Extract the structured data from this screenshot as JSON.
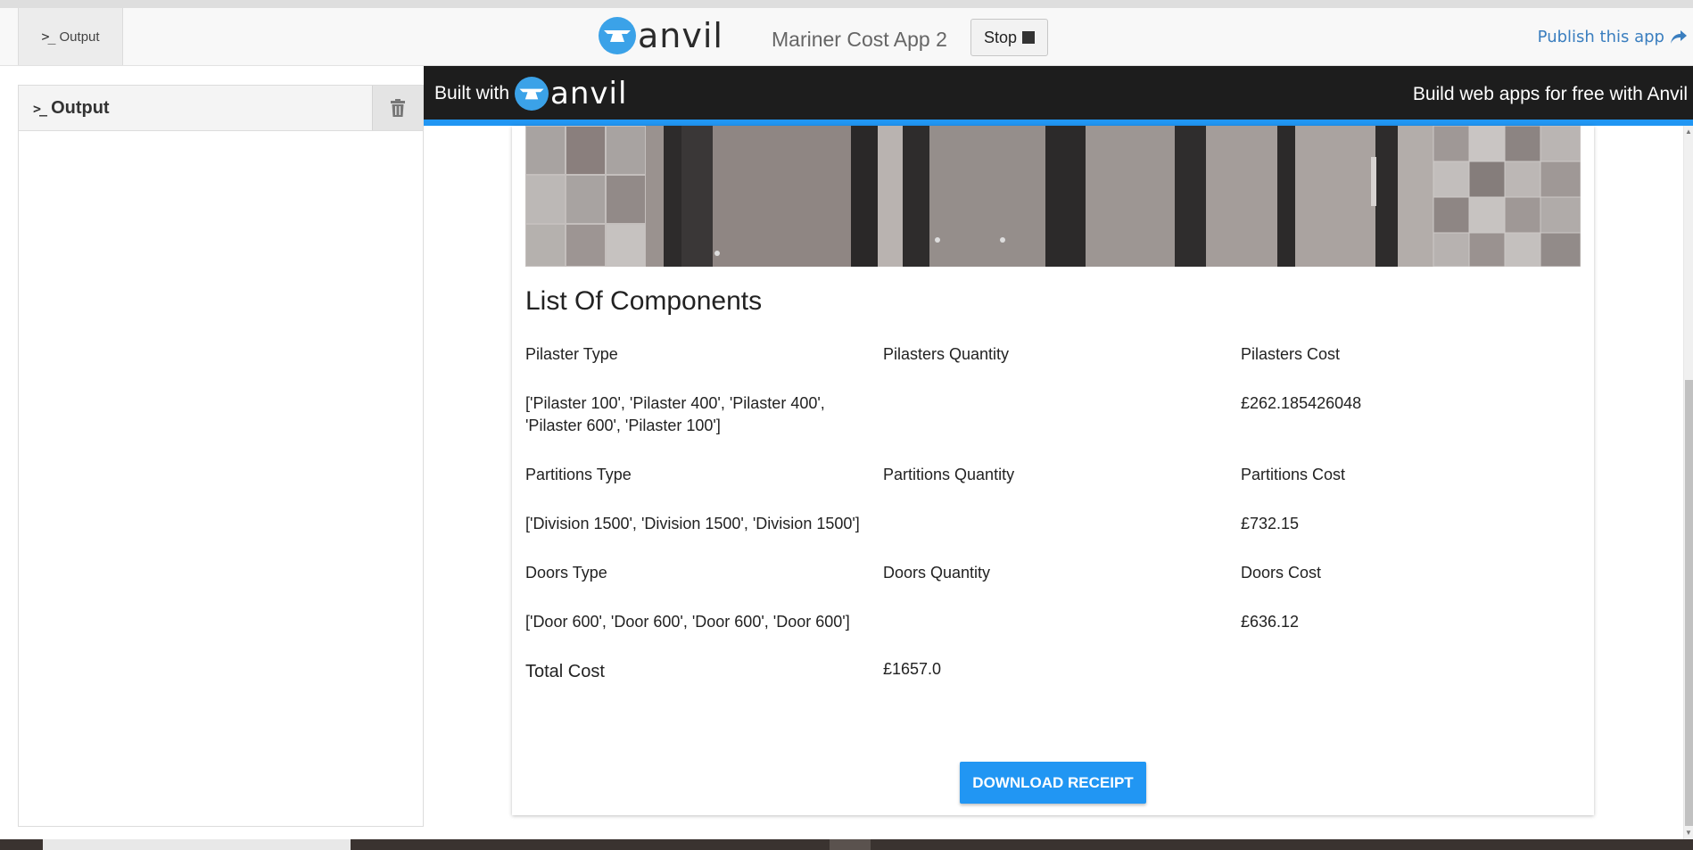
{
  "topbar": {
    "output_tab_label": "Output",
    "logo_text": "anvil",
    "app_name": "Mariner Cost App 2",
    "stop_label": "Stop",
    "publish_label": "Publish this app"
  },
  "output_panel": {
    "title": "Output"
  },
  "banner": {
    "built_with_label": "Built with",
    "logo_text": "anvil",
    "cta_label": "Build web apps for free with Anvil"
  },
  "components": {
    "title": "List Of Components",
    "pilasters": {
      "type_header": "Pilaster Type",
      "qty_header": "Pilasters Quantity",
      "cost_header": "Pilasters Cost",
      "type_value_line1": "['Pilaster 100', 'Pilaster 400', 'Pilaster 400',",
      "type_value_line2": "'Pilaster 600', 'Pilaster 100']",
      "cost_value": "£262.185426048"
    },
    "partitions": {
      "type_header": "Partitions Type",
      "qty_header": "Partitions Quantity",
      "cost_header": "Partitions Cost",
      "type_value": "['Division 1500', 'Division 1500', 'Division 1500']",
      "cost_value": "£732.15"
    },
    "doors": {
      "type_header": "Doors Type",
      "qty_header": "Doors Quantity",
      "cost_header": "Doors Cost",
      "type_value": "['Door 600', 'Door 600', 'Door 600', 'Door 600']",
      "cost_value": "£636.12"
    },
    "total": {
      "label": "Total Cost",
      "value": "£1657.0"
    },
    "download_label": "DOWNLOAD RECEIPT"
  },
  "colors": {
    "accent": "#2196f3",
    "banner_bg": "#1d1d1d",
    "logo_blue": "#3ba2e8",
    "publish_link": "#3a7ebf"
  }
}
